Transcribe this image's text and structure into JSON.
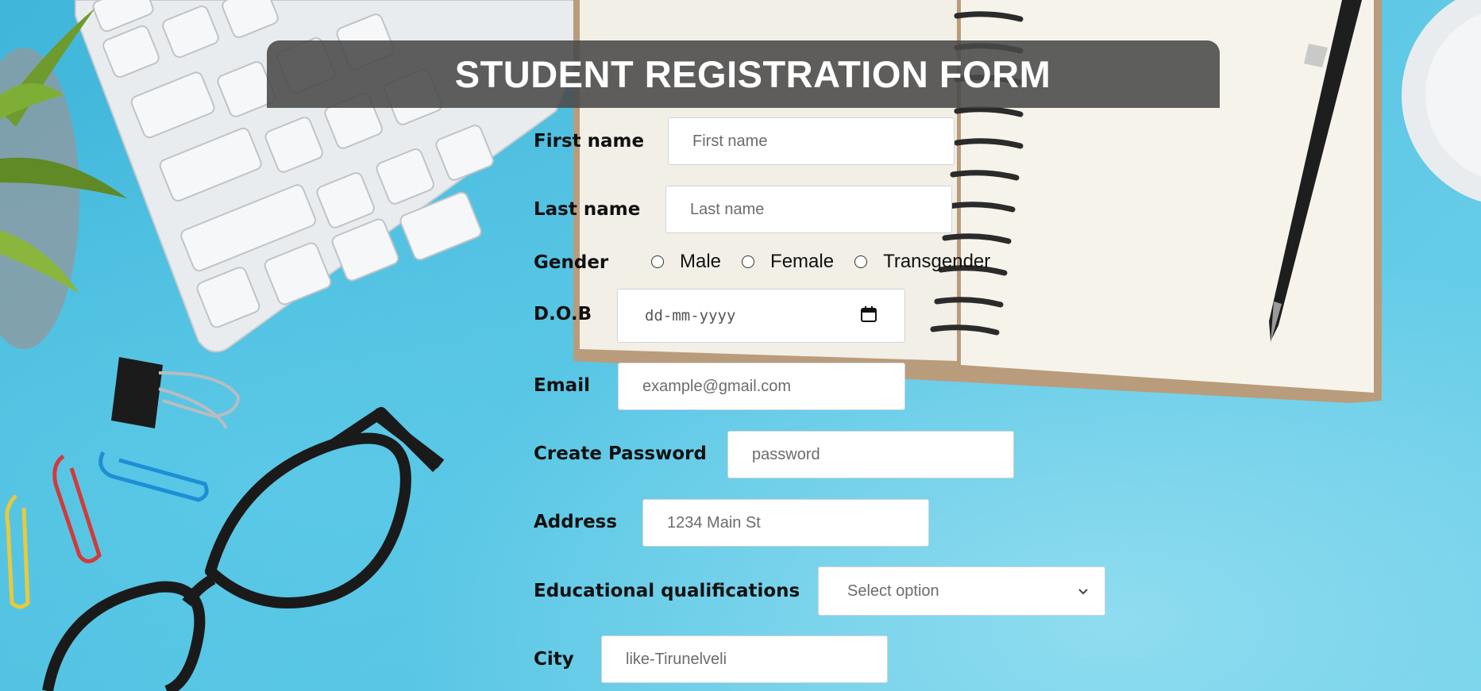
{
  "form": {
    "title": "STUDENT REGISTRATION FORM",
    "first_name": {
      "label": "First name",
      "placeholder": "First name"
    },
    "last_name": {
      "label": "Last name",
      "placeholder": "Last name"
    },
    "gender": {
      "label": "Gender",
      "options": [
        "Male",
        "Female",
        "Transgender"
      ]
    },
    "dob": {
      "label": "D.O.B",
      "placeholder": "dd-mm-yyyy"
    },
    "email": {
      "label": "Email",
      "placeholder": "example@gmail.com"
    },
    "password": {
      "label": "Create Password",
      "placeholder": "password"
    },
    "address": {
      "label": "Address",
      "placeholder": "1234 Main St"
    },
    "education": {
      "label": "Educational qualifications",
      "selected": "Select option"
    },
    "city": {
      "label": "City",
      "placeholder": "like-Tirunelveli"
    }
  },
  "icons": {
    "calendar": "calendar-icon",
    "dropdown": "chevron-down-icon"
  },
  "colors": {
    "background": "#4fc1e1",
    "title_bar": "#494949",
    "title_text": "#ffffff",
    "label_text": "#111111"
  }
}
